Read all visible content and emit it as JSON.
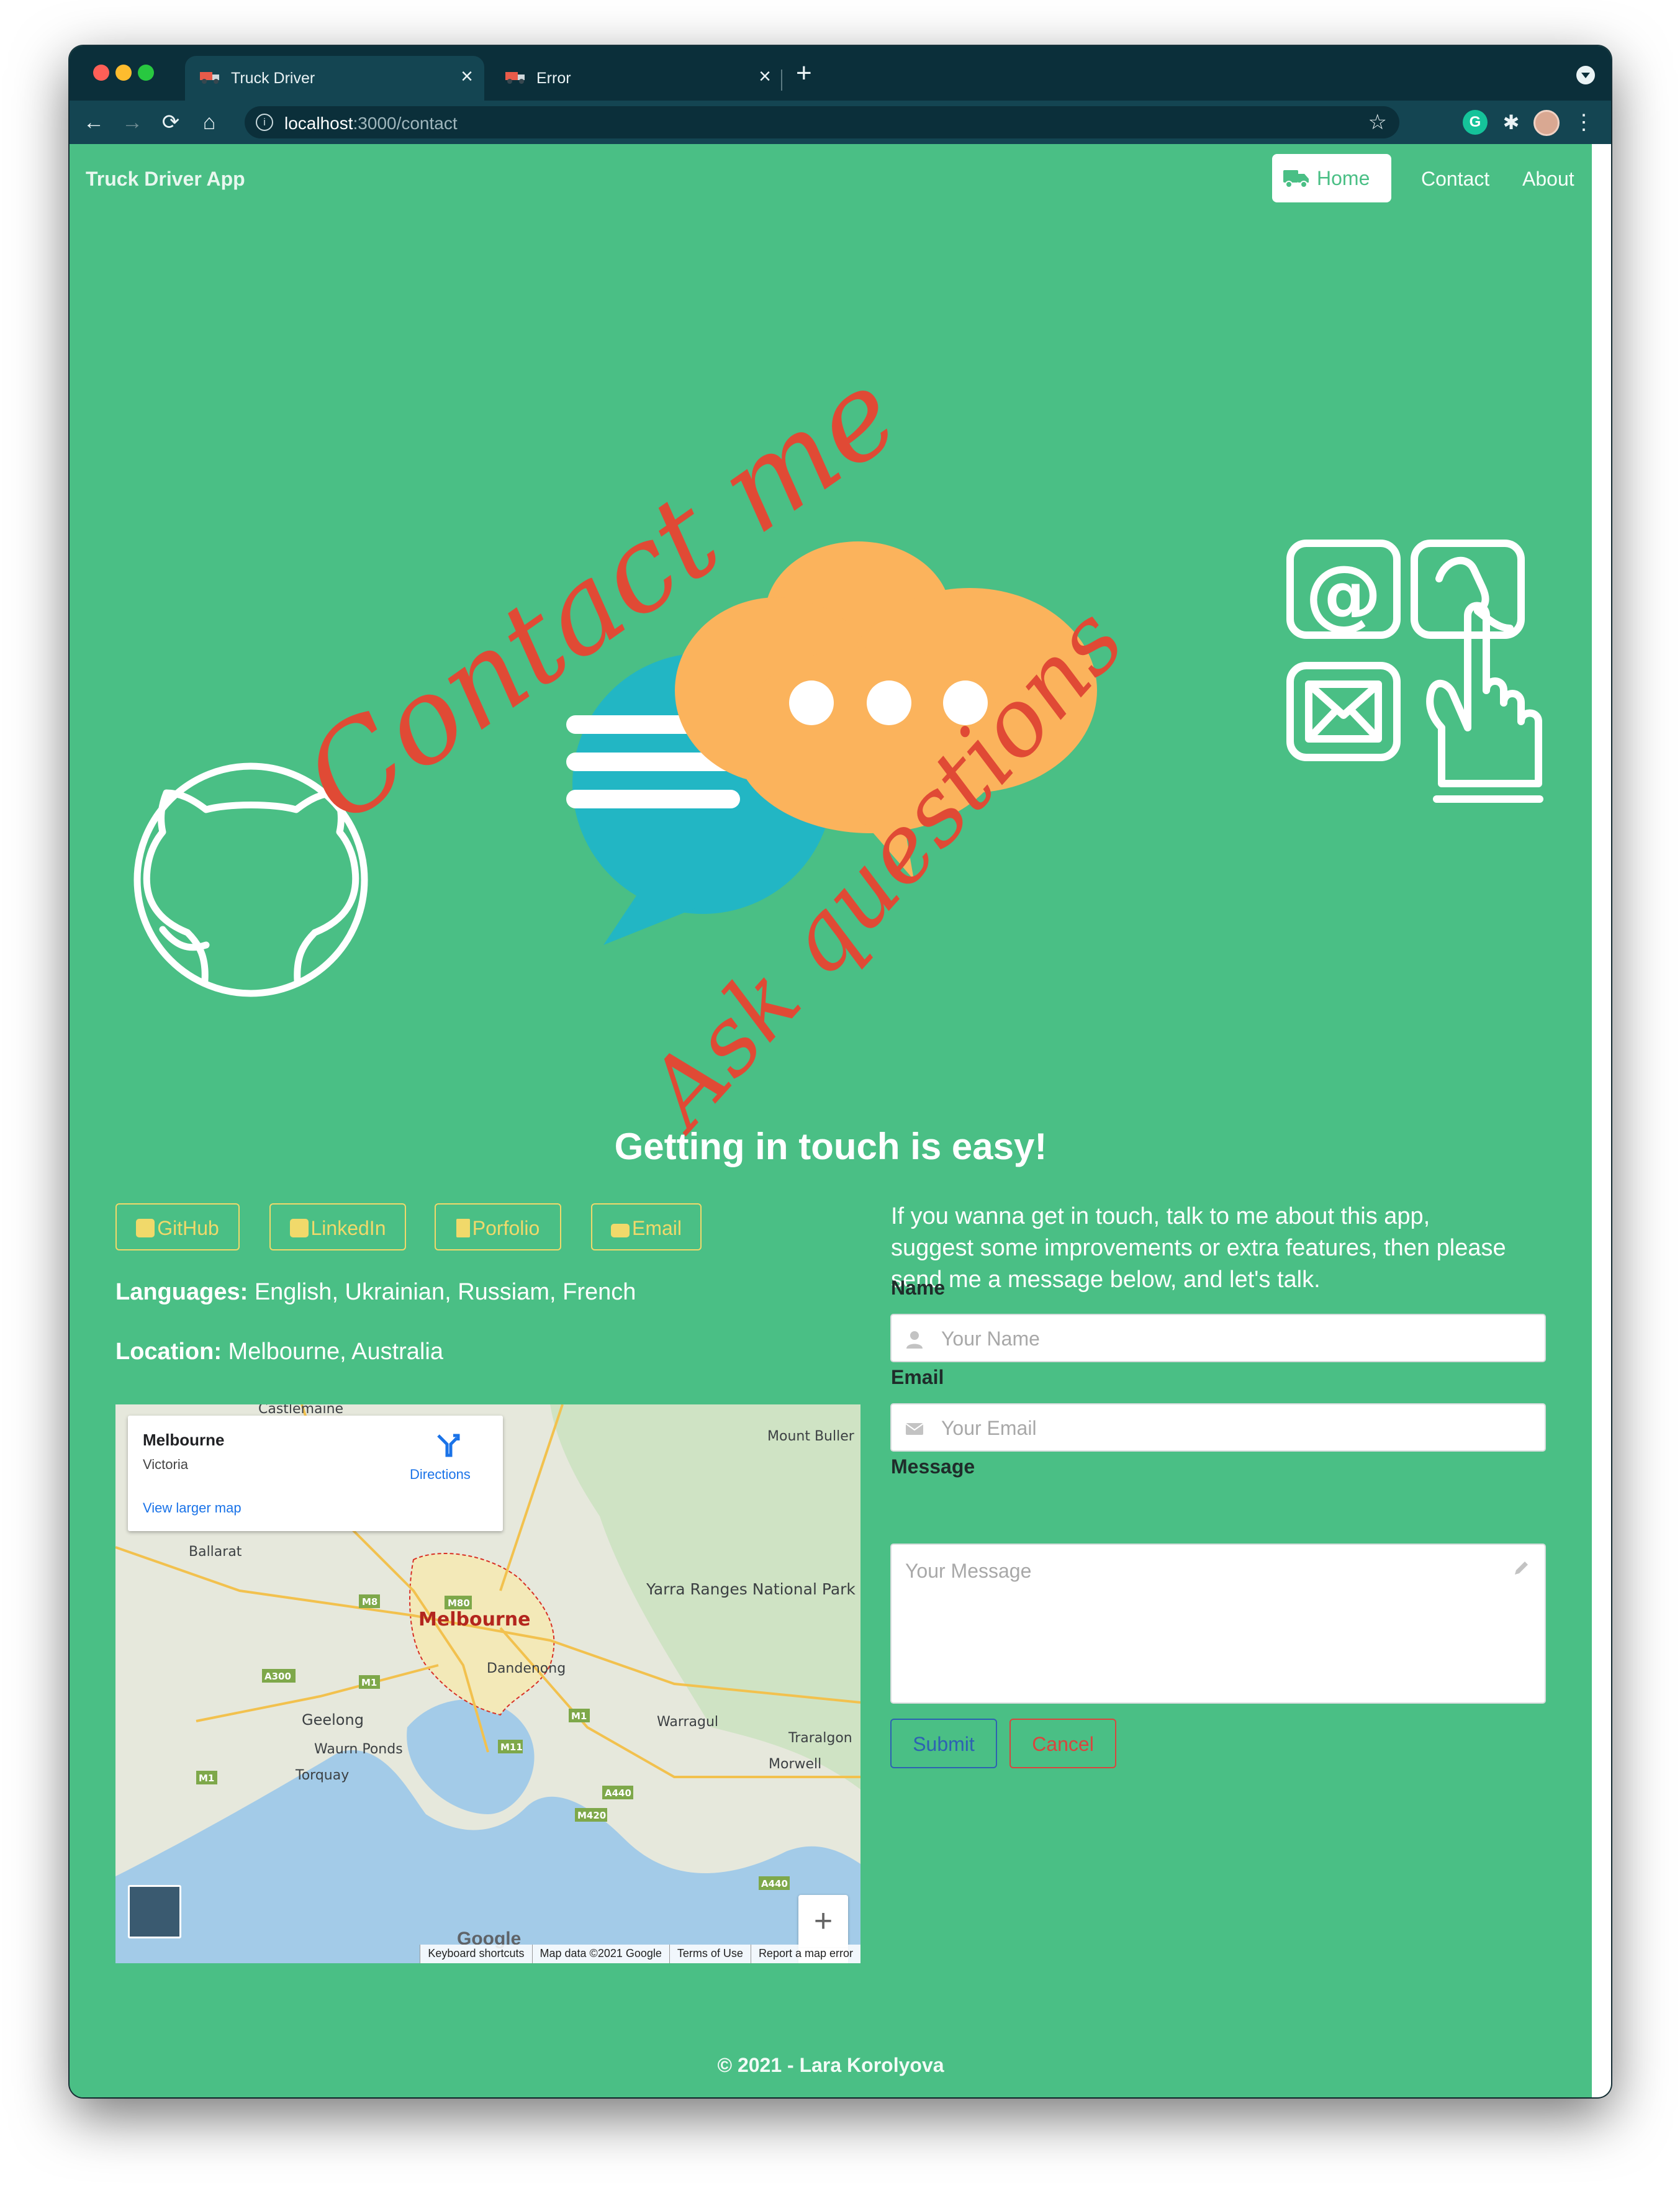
{
  "browser": {
    "tabs": [
      {
        "title": "Truck Driver",
        "close": "×"
      },
      {
        "title": "Error",
        "close": "×"
      }
    ],
    "new_tab": "+",
    "url_host": "localhost",
    "url_path": ":3000/contact",
    "nav": {
      "back": "←",
      "forward": "→",
      "reload": "⟳",
      "home": "⌂",
      "star": "☆",
      "menu": "⋮",
      "info": "i",
      "ext_g": "G",
      "ext_puzzle": "✱"
    }
  },
  "navbar": {
    "brand": "Truck Driver App",
    "links": [
      {
        "label": "Home",
        "active": true
      },
      {
        "label": "Contact"
      },
      {
        "label": "About"
      }
    ]
  },
  "hero": {
    "script_top": "Contact me",
    "script_bottom": "Ask questions",
    "icons": [
      "github-icon",
      "chat-bubbles-icon",
      "at-icon",
      "phone-icon",
      "mail-icon",
      "pointer-hand-icon"
    ]
  },
  "tagline": "Getting in touch is easy!",
  "social": [
    {
      "label": "GitHub",
      "icon": "github-icon"
    },
    {
      "label": "LinkedIn",
      "icon": "linkedin-icon"
    },
    {
      "label": "Porfolio",
      "icon": "bookmark-icon"
    },
    {
      "label": "Email",
      "icon": "envelope-icon"
    }
  ],
  "info": {
    "languages_label": "Languages:",
    "languages": "English, Ukrainian, Russiam, French",
    "location_label": "Location:",
    "location": "Melbourne, Australia"
  },
  "map": {
    "card_place": "Melbourne",
    "card_region": "Victoria",
    "card_directions": "Directions",
    "card_larger": "View larger map",
    "places": [
      "Castlemaine",
      "Mount Buller",
      "Ballarat",
      "Yarra Ranges National Park",
      "Melbourne",
      "Dandenong",
      "Geelong",
      "Waurn Ponds",
      "Torquay",
      "Warragul",
      "Traralgon",
      "Morwell"
    ],
    "roads": [
      "M8",
      "M80",
      "A300",
      "M1",
      "M1",
      "M11",
      "A440",
      "M420",
      "A440",
      "M1"
    ],
    "footer": [
      "Keyboard shortcuts",
      "Map data ©2021 Google",
      "Terms of Use",
      "Report a map error"
    ],
    "logo": "Google",
    "zoom_in": "+",
    "zoom_out": "−"
  },
  "contact": {
    "intro": "If you wanna get in touch, talk to me about this app, suggest some improvements or extra features, then please send me a message below, and let's talk.",
    "name_label": "Name",
    "name_placeholder": "Your Name",
    "email_label": "Email",
    "email_placeholder": "Your Email",
    "message_label": "Message",
    "message_placeholder": "Your Message",
    "submit": "Submit",
    "cancel": "Cancel"
  },
  "footer": "© 2021 - Lara Korolyova",
  "colors": {
    "page_bg": "#4abf85",
    "accent_yellow": "#f1d96a",
    "script_red": "#e04a35",
    "bubble_teal": "#22b6c4",
    "bubble_orange": "#fbb35c",
    "submit_blue": "#2d62b2",
    "cancel_red": "#d9453e"
  }
}
